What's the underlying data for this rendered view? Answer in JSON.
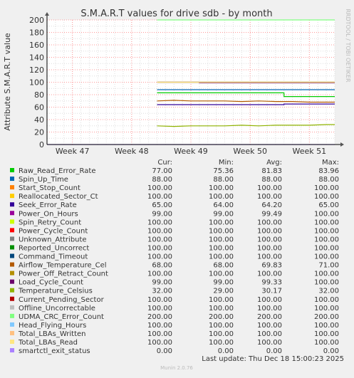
{
  "colors": {
    "background": "#f0f0f0",
    "plot_background": "#ffffff",
    "grid_major": "#ff9999",
    "grid_minor": "#dddddd",
    "text": "#333333",
    "faint_text": "#bbbbbb"
  },
  "chart_data": {
    "type": "line",
    "title": "S.M.A.R.T values for drive sdb - by month",
    "ylabel": "Attribute S.M.A.R.T value",
    "xlabel": "",
    "ylim": [
      0,
      200
    ],
    "yticks": [
      0,
      20,
      40,
      60,
      80,
      100,
      120,
      140,
      160,
      180,
      200
    ],
    "x_range": [
      "2025-11-14",
      "2025-12-18"
    ],
    "data_start": "2025-11-27",
    "xticks": [
      {
        "label": "Week 47",
        "date": "2025-11-17"
      },
      {
        "label": "Week 48",
        "date": "2025-11-24"
      },
      {
        "label": "Week 49",
        "date": "2025-12-01"
      },
      {
        "label": "Week 50",
        "date": "2025-12-08"
      },
      {
        "label": "Week 51",
        "date": "2025-12-15"
      }
    ],
    "grid": true,
    "legend_position": "bottom",
    "side_label": "RRDTOOL / TOBI OETIKER",
    "column_headers": {
      "cur": "Cur:",
      "min": "Min:",
      "avg": "Avg:",
      "max": "Max:"
    },
    "series": [
      {
        "name": "Raw_Read_Error_Rate",
        "color": "#00cc00",
        "cur": "77.00",
        "min": "75.36",
        "avg": "81.83",
        "max": "83.96",
        "points": [
          [
            "2025-11-27",
            83
          ],
          [
            "2025-12-12",
            83
          ],
          [
            "2025-12-12",
            77
          ],
          [
            "2025-12-18",
            77
          ]
        ]
      },
      {
        "name": "Spin_Up_Time",
        "color": "#0066b3",
        "cur": "88.00",
        "min": "88.00",
        "avg": "88.00",
        "max": "88.00",
        "points": [
          [
            "2025-11-27",
            88
          ],
          [
            "2025-12-18",
            88
          ]
        ]
      },
      {
        "name": "Start_Stop_Count",
        "color": "#ff8000",
        "cur": "100.00",
        "min": "100.00",
        "avg": "100.00",
        "max": "100.00",
        "points": [
          [
            "2025-11-27",
            100
          ],
          [
            "2025-12-18",
            100
          ]
        ]
      },
      {
        "name": "Reallocated_Sector_Ct",
        "color": "#ffcc00",
        "cur": "100.00",
        "min": "100.00",
        "avg": "100.00",
        "max": "100.00",
        "points": [
          [
            "2025-11-27",
            100
          ],
          [
            "2025-12-18",
            100
          ]
        ]
      },
      {
        "name": "Seek_Error_Rate",
        "color": "#330099",
        "cur": "65.00",
        "min": "64.00",
        "avg": "64.20",
        "max": "65.00",
        "points": [
          [
            "2025-11-27",
            64
          ],
          [
            "2025-12-12",
            64
          ],
          [
            "2025-12-12",
            65
          ],
          [
            "2025-12-18",
            65
          ]
        ]
      },
      {
        "name": "Power_On_Hours",
        "color": "#990099",
        "cur": "99.00",
        "min": "99.00",
        "avg": "99.49",
        "max": "100.00",
        "points": [
          [
            "2025-11-27",
            100
          ],
          [
            "2025-12-02",
            100
          ],
          [
            "2025-12-02",
            99
          ],
          [
            "2025-12-18",
            99
          ]
        ]
      },
      {
        "name": "Spin_Retry_Count",
        "color": "#ccff00",
        "cur": "100.00",
        "min": "100.00",
        "avg": "100.00",
        "max": "100.00",
        "points": [
          [
            "2025-11-27",
            100
          ],
          [
            "2025-12-18",
            100
          ]
        ]
      },
      {
        "name": "Power_Cycle_Count",
        "color": "#ff0000",
        "cur": "100.00",
        "min": "100.00",
        "avg": "100.00",
        "max": "100.00",
        "points": [
          [
            "2025-11-27",
            100
          ],
          [
            "2025-12-18",
            100
          ]
        ]
      },
      {
        "name": "Unknown_Attribute",
        "color": "#808080",
        "cur": "100.00",
        "min": "100.00",
        "avg": "100.00",
        "max": "100.00",
        "points": [
          [
            "2025-11-27",
            100
          ],
          [
            "2025-12-18",
            100
          ]
        ]
      },
      {
        "name": "Reported_Uncorrect",
        "color": "#008f00",
        "cur": "100.00",
        "min": "100.00",
        "avg": "100.00",
        "max": "100.00",
        "points": [
          [
            "2025-11-27",
            100
          ],
          [
            "2025-12-18",
            100
          ]
        ]
      },
      {
        "name": "Command_Timeout",
        "color": "#00487d",
        "cur": "100.00",
        "min": "100.00",
        "avg": "100.00",
        "max": "100.00",
        "points": [
          [
            "2025-11-27",
            100
          ],
          [
            "2025-12-18",
            100
          ]
        ]
      },
      {
        "name": "Airflow_Temperature_Cel",
        "color": "#b35a00",
        "cur": "68.00",
        "min": "68.00",
        "avg": "69.83",
        "max": "71.00",
        "points": [
          [
            "2025-11-27",
            70
          ],
          [
            "2025-11-29",
            71
          ],
          [
            "2025-12-01",
            70
          ],
          [
            "2025-12-03",
            70
          ],
          [
            "2025-12-05",
            70
          ],
          [
            "2025-12-07",
            69
          ],
          [
            "2025-12-09",
            70
          ],
          [
            "2025-12-11",
            69
          ],
          [
            "2025-12-13",
            69
          ],
          [
            "2025-12-15",
            68
          ],
          [
            "2025-12-18",
            68
          ]
        ]
      },
      {
        "name": "Power_Off_Retract_Count",
        "color": "#b38f00",
        "cur": "100.00",
        "min": "100.00",
        "avg": "100.00",
        "max": "100.00",
        "points": [
          [
            "2025-11-27",
            100
          ],
          [
            "2025-12-18",
            100
          ]
        ]
      },
      {
        "name": "Load_Cycle_Count",
        "color": "#6b006b",
        "cur": "99.00",
        "min": "99.00",
        "avg": "99.33",
        "max": "100.00",
        "points": [
          [
            "2025-11-27",
            100
          ],
          [
            "2025-12-02",
            100
          ],
          [
            "2025-12-02",
            99
          ],
          [
            "2025-12-18",
            99
          ]
        ]
      },
      {
        "name": "Temperature_Celsius",
        "color": "#8fb300",
        "cur": "32.00",
        "min": "29.00",
        "avg": "30.17",
        "max": "32.00",
        "points": [
          [
            "2025-11-27",
            30
          ],
          [
            "2025-11-29",
            29
          ],
          [
            "2025-12-01",
            30
          ],
          [
            "2025-12-03",
            30
          ],
          [
            "2025-12-05",
            30
          ],
          [
            "2025-12-07",
            31
          ],
          [
            "2025-12-09",
            30
          ],
          [
            "2025-12-11",
            31
          ],
          [
            "2025-12-13",
            31
          ],
          [
            "2025-12-15",
            31
          ],
          [
            "2025-12-17",
            32
          ],
          [
            "2025-12-18",
            32
          ]
        ]
      },
      {
        "name": "Current_Pending_Sector",
        "color": "#b30000",
        "cur": "100.00",
        "min": "100.00",
        "avg": "100.00",
        "max": "100.00",
        "points": [
          [
            "2025-11-27",
            100
          ],
          [
            "2025-12-18",
            100
          ]
        ]
      },
      {
        "name": "Offline_Uncorrectable",
        "color": "#bebebe",
        "cur": "100.00",
        "min": "100.00",
        "avg": "100.00",
        "max": "100.00",
        "points": [
          [
            "2025-11-27",
            100
          ],
          [
            "2025-12-18",
            100
          ]
        ]
      },
      {
        "name": "UDMA_CRC_Error_Count",
        "color": "#80ff80",
        "cur": "200.00",
        "min": "200.00",
        "avg": "200.00",
        "max": "200.00",
        "points": [
          [
            "2025-11-27",
            200
          ],
          [
            "2025-12-18",
            200
          ]
        ]
      },
      {
        "name": "Head_Flying_Hours",
        "color": "#80c9ff",
        "cur": "100.00",
        "min": "100.00",
        "avg": "100.00",
        "max": "100.00",
        "points": [
          [
            "2025-11-27",
            100
          ],
          [
            "2025-12-18",
            100
          ]
        ]
      },
      {
        "name": "Total_LBAs_Written",
        "color": "#ffc080",
        "cur": "100.00",
        "min": "100.00",
        "avg": "100.00",
        "max": "100.00",
        "points": [
          [
            "2025-11-27",
            100
          ],
          [
            "2025-12-18",
            100
          ]
        ]
      },
      {
        "name": "Total_LBAs_Read",
        "color": "#ffe680",
        "cur": "100.00",
        "min": "100.00",
        "avg": "100.00",
        "max": "100.00",
        "points": [
          [
            "2025-11-27",
            100
          ],
          [
            "2025-12-18",
            100
          ]
        ]
      },
      {
        "name": "smartctl_exit_status",
        "color": "#aa80ff",
        "cur": "0.00",
        "min": "0.00",
        "avg": "0.00",
        "max": "0.00",
        "points": [
          [
            "2025-11-14",
            0
          ],
          [
            "2025-12-18",
            0
          ]
        ]
      }
    ],
    "last_update": "Last update: Thu Dec 18 15:00:23 2025",
    "footer": "Munin 2.0.76"
  }
}
